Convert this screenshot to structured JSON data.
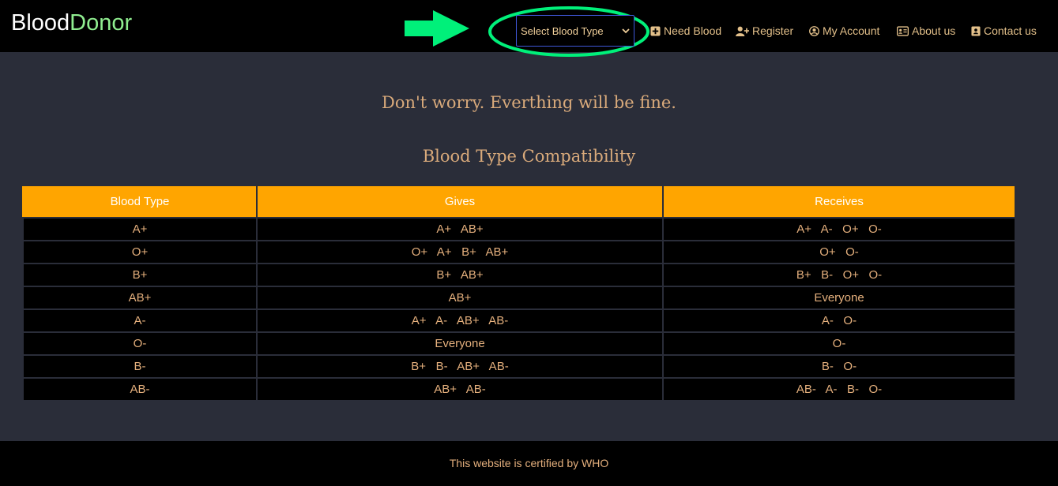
{
  "brand": {
    "part1": "Blood",
    "part2": "Donor"
  },
  "select": {
    "selected": "Select Blood Type"
  },
  "nav": [
    {
      "label": "Need Blood",
      "icon": "plus-square-icon"
    },
    {
      "label": "Register",
      "icon": "user-plus-icon"
    },
    {
      "label": "My Account",
      "icon": "user-circle-icon"
    },
    {
      "label": "About us",
      "icon": "id-card-icon"
    },
    {
      "label": "Contact us",
      "icon": "address-book-icon"
    }
  ],
  "main": {
    "tagline": "Don't worry. Everthing will be fine.",
    "title": "Blood Type Compatibility"
  },
  "table": {
    "headers": [
      "Blood Type",
      "Gives",
      "Receives"
    ],
    "rows": [
      [
        "A+",
        "A+   AB+",
        "A+   A-   O+   O-"
      ],
      [
        "O+",
        "O+   A+   B+   AB+",
        "O+   O-"
      ],
      [
        "B+",
        "B+   AB+",
        "B+   B-   O+   O-"
      ],
      [
        "AB+",
        "AB+",
        "Everyone"
      ],
      [
        "A-",
        "A+   A-   AB+   AB-",
        "A-   O-"
      ],
      [
        "O-",
        "Everyone",
        "O-"
      ],
      [
        "B-",
        "B+   B-   AB+   AB-",
        "B-   O-"
      ],
      [
        "AB-",
        "AB+   AB-",
        "AB-   A-   B-   O-"
      ]
    ]
  },
  "footer": {
    "text": "This website is certified by WHO"
  },
  "colors": {
    "navbar": "#000000",
    "page": "#2a2d39",
    "accent_green": "#90ee90",
    "header_orange": "#ffa500",
    "text_gold": "#e5b07d",
    "annotation_green": "#00f07a"
  }
}
